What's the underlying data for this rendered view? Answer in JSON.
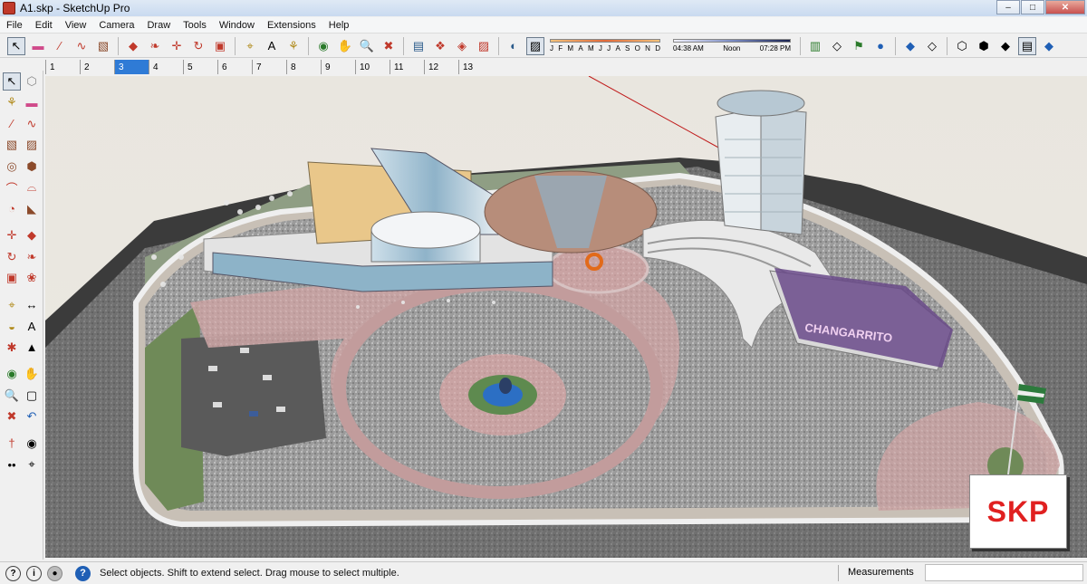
{
  "window": {
    "title": "A1.skp - SketchUp Pro",
    "btn_min": "–",
    "btn_max": "□",
    "btn_close": "✕"
  },
  "menu": [
    "File",
    "Edit",
    "View",
    "Camera",
    "Draw",
    "Tools",
    "Window",
    "Extensions",
    "Help"
  ],
  "shadows": {
    "months": [
      "J",
      "F",
      "M",
      "A",
      "M",
      "J",
      "J",
      "A",
      "S",
      "O",
      "N",
      "D"
    ],
    "time_start": "04:38 AM",
    "time_mid": "Noon",
    "time_end": "07:28 PM"
  },
  "scenes": [
    "1",
    "2",
    "3",
    "4",
    "5",
    "6",
    "7",
    "8",
    "9",
    "10",
    "11",
    "12",
    "13"
  ],
  "active_scene": "3",
  "status": {
    "message": "Select objects. Shift to extend select. Drag mouse to select multiple.",
    "measurements_label": "Measurements",
    "measurements_value": ""
  },
  "billboard": {
    "line1": "CHANGARRITO",
    "line2": "CHANGARRITO"
  },
  "badge": "SKP",
  "colors": {
    "accent": "#2f7bd6",
    "badge": "#e02020"
  }
}
